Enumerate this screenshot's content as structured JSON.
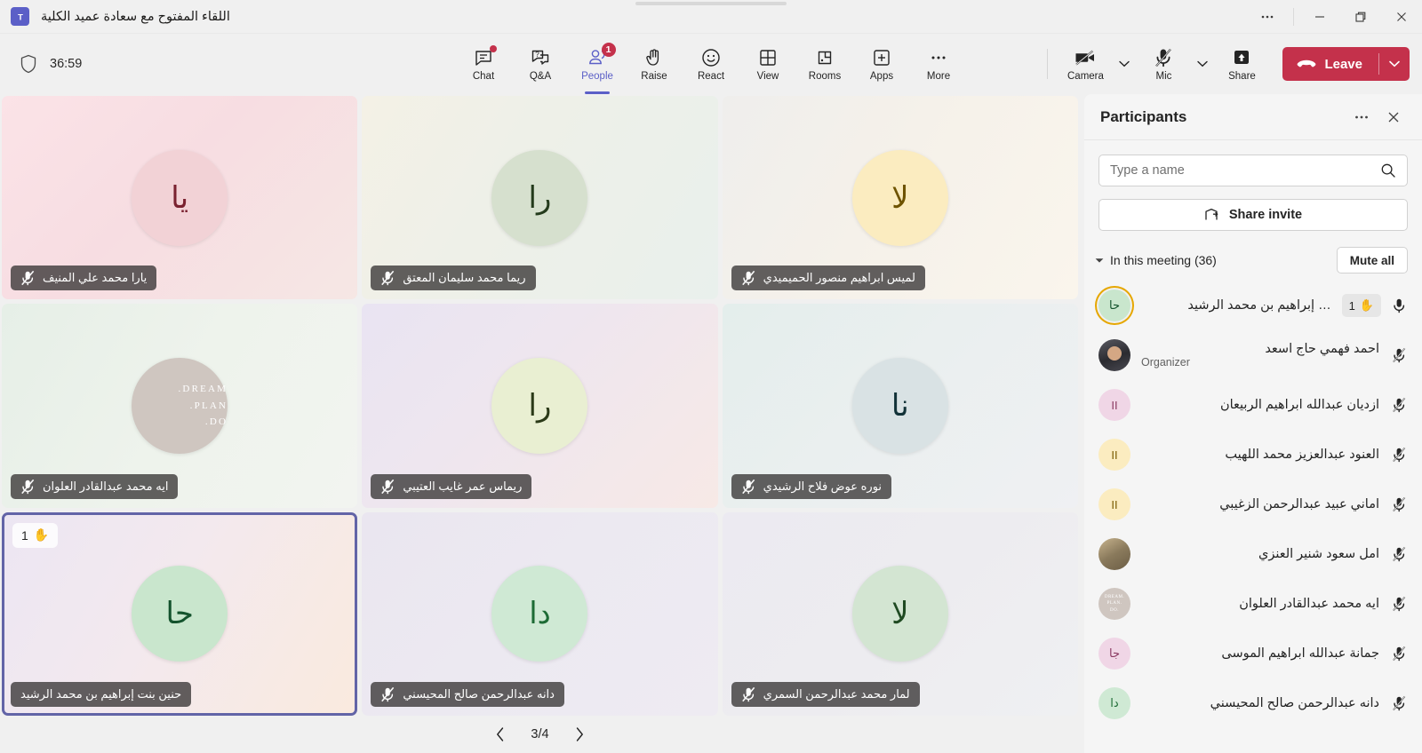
{
  "window": {
    "app_title": "اللقاء المفتوح مع سعادة عميد الكلية",
    "logo_text": "Ti",
    "more_label": "···",
    "minimize_label": "—",
    "restore_label": "❐",
    "close_label": "✕"
  },
  "toolbar": {
    "timer": "36:59",
    "shield_icon": "shield-icon",
    "items": [
      {
        "label": "Chat",
        "icon": "chat-icon",
        "badge_dot": true,
        "badge": "",
        "active": false
      },
      {
        "label": "Q&A",
        "icon": "qa-icon",
        "badge_dot": false,
        "badge": "",
        "active": false
      },
      {
        "label": "People",
        "icon": "people-icon",
        "badge_dot": false,
        "badge": "1",
        "active": true
      },
      {
        "label": "Raise",
        "icon": "hand-icon",
        "badge_dot": false,
        "badge": "",
        "active": false
      },
      {
        "label": "React",
        "icon": "smiley-icon",
        "badge_dot": false,
        "badge": "",
        "active": false
      },
      {
        "label": "View",
        "icon": "grid-icon",
        "badge_dot": false,
        "badge": "",
        "active": false
      },
      {
        "label": "Rooms",
        "icon": "rooms-icon",
        "badge_dot": false,
        "badge": "",
        "active": false
      },
      {
        "label": "Apps",
        "icon": "plus-icon",
        "badge_dot": false,
        "badge": "",
        "active": false
      },
      {
        "label": "More",
        "icon": "ellipsis-icon",
        "badge_dot": false,
        "badge": "",
        "active": false
      }
    ],
    "camera": {
      "label": "Camera",
      "icon": "camera-off-icon",
      "state": "off"
    },
    "mic": {
      "label": "Mic",
      "icon": "mic-off-icon",
      "state": "muted"
    },
    "share": {
      "label": "Share",
      "icon": "share-up-icon"
    },
    "leave": {
      "label": "Leave",
      "icon": "call-end-icon",
      "color": "#c4314b"
    }
  },
  "stage": {
    "tiles": [
      {
        "name": "يارا محمد علي المنيف",
        "initials": "يا",
        "muted": true,
        "hand": "",
        "speaking": false,
        "av_bg": "#f2d2d6",
        "av_fg": "#7a2230",
        "tile_bg": "linear-gradient(135deg,#fbe3e7 0%,#f7dde2 45%,#f6e7e4 100%)",
        "photo": false
      },
      {
        "name": "ريما محمد سليمان المعتق",
        "initials": "را",
        "muted": true,
        "hand": "",
        "speaking": false,
        "av_bg": "#d6e0ce",
        "av_fg": "#243b1c",
        "tile_bg": "linear-gradient(120deg,#f4f1e6 0%,#eef0e8 40%,#e9f0ec 100%)",
        "photo": false
      },
      {
        "name": "لميس ابراهيم منصور الحميميدي",
        "initials": "لا",
        "muted": true,
        "hand": "",
        "speaking": false,
        "av_bg": "#fbecc0",
        "av_fg": "#6e5300",
        "tile_bg": "linear-gradient(120deg,#efeeec 0%,#f5f1ea 45%,#faf5ec 100%)",
        "photo": false
      },
      {
        "name": "ايه محمد عبدالقادر العلوان",
        "initials": "",
        "muted": true,
        "hand": "",
        "speaking": false,
        "av_bg": "#cfc6c0",
        "av_fg": "#ffffff",
        "tile_bg": "linear-gradient(120deg,#e6efe7 0%,#eef3ec 50%,#f2f4f0 100%)",
        "photo": true,
        "photo_lines": [
          "DREAM.",
          "PLAN.",
          "DO."
        ]
      },
      {
        "name": "ريماس عمر غايب العتيبي",
        "initials": "را",
        "muted": true,
        "hand": "",
        "speaking": false,
        "av_bg": "#e9efd2",
        "av_fg": "#2b3a17",
        "tile_bg": "linear-gradient(135deg,#e9e4f2 0%,#eee6ef 40%,#f7e9e6 100%)",
        "photo": false
      },
      {
        "name": "نوره عوض فلاح الرشيدي",
        "initials": "نا",
        "muted": true,
        "hand": "",
        "speaking": false,
        "av_bg": "#d9e2e4",
        "av_fg": "#123238",
        "tile_bg": "linear-gradient(135deg,#e4eeec 0%,#eaefef 45%,#eff0f3 100%)",
        "photo": false
      },
      {
        "name": "حنين بنت إبراهيم بن محمد الرشيد",
        "initials": "حا",
        "muted": false,
        "hand": "1",
        "speaking": true,
        "av_bg": "#c9e6cd",
        "av_fg": "#14532d",
        "tile_bg": "linear-gradient(120deg,#ece6f3 0%,#f3e9ee 45%,#faeade 100%)",
        "photo": false
      },
      {
        "name": "دانه عبدالرحمن صالح المحيسني",
        "initials": "دا",
        "muted": true,
        "hand": "",
        "speaking": false,
        "av_bg": "#cfe9d4",
        "av_fg": "#1d6b35",
        "tile_bg": "linear-gradient(135deg,#eae6f0 0%,#ece9f1 45%,#eeebf2 100%)",
        "photo": false
      },
      {
        "name": "لمار محمد عبدالرحمن السمري",
        "initials": "لا",
        "muted": true,
        "hand": "",
        "speaking": false,
        "av_bg": "#d3e5d2",
        "av_fg": "#1f4a22",
        "tile_bg": "linear-gradient(135deg,#eceaf1 0%,#edecf0 50%,#eff0f2 100%)",
        "photo": false
      }
    ],
    "pager": {
      "page": "3/4",
      "prev_icon": "chevron-left-icon",
      "next_icon": "chevron-right-icon"
    }
  },
  "panel": {
    "title": "Participants",
    "more_icon": "ellipsis-icon",
    "close_icon": "close-icon",
    "search": {
      "placeholder": "Type a name",
      "value": "",
      "icon": "search-icon"
    },
    "share_invite": {
      "label": "Share invite",
      "icon": "share-invite-icon"
    },
    "section": {
      "label": "In this meeting (36)",
      "caret": "▾"
    },
    "mute_all": "Mute all",
    "participants": [
      {
        "name": "… إبراهيم بن محمد الرشيد",
        "role": "",
        "initials": "حا",
        "av_bg": "#c9e6cd",
        "av_fg": "#14532d",
        "ring": true,
        "photo": "",
        "hand": "1",
        "muted": false
      },
      {
        "name": "احمد فهمي حاج اسعد",
        "role": "Organizer",
        "initials": "",
        "av_bg": "",
        "av_fg": "",
        "ring": false,
        "photo": "photo-q",
        "hand": "",
        "muted": true
      },
      {
        "name": "ازديان عبدالله ابراهيم الربيعان",
        "role": "",
        "initials": "II",
        "av_bg": "#f0d6e6",
        "av_fg": "#8b3a62",
        "ring": false,
        "photo": "",
        "hand": "",
        "muted": true
      },
      {
        "name": "العنود عبدالعزيز محمد اللهيب",
        "role": "",
        "initials": "II",
        "av_bg": "#fbecc0",
        "av_fg": "#7a5a00",
        "ring": false,
        "photo": "",
        "hand": "",
        "muted": true
      },
      {
        "name": "اماني عبيد عبدالرحمن الزغيبي",
        "role": "",
        "initials": "II",
        "av_bg": "#fbecc0",
        "av_fg": "#7a5a00",
        "ring": false,
        "photo": "",
        "hand": "",
        "muted": true
      },
      {
        "name": "امل سعود شنير العنزي",
        "role": "",
        "initials": "",
        "av_bg": "",
        "av_fg": "",
        "ring": false,
        "photo": "photo-p",
        "hand": "",
        "muted": true
      },
      {
        "name": "ايه محمد عبدالقادر العلوان",
        "role": "",
        "initials": "",
        "av_bg": "",
        "av_fg": "",
        "ring": false,
        "photo": "photo-r",
        "hand": "",
        "muted": true
      },
      {
        "name": "جمانة عبدالله ابراهيم الموسى",
        "role": "",
        "initials": "جا",
        "av_bg": "#f0d6e6",
        "av_fg": "#8b3a62",
        "ring": false,
        "photo": "",
        "hand": "",
        "muted": true
      },
      {
        "name": "دانه عبدالرحمن صالح المحيسني",
        "role": "",
        "initials": "دا",
        "av_bg": "#cfe9d4",
        "av_fg": "#1d6b35",
        "ring": false,
        "photo": "",
        "hand": "",
        "muted": true
      }
    ]
  }
}
